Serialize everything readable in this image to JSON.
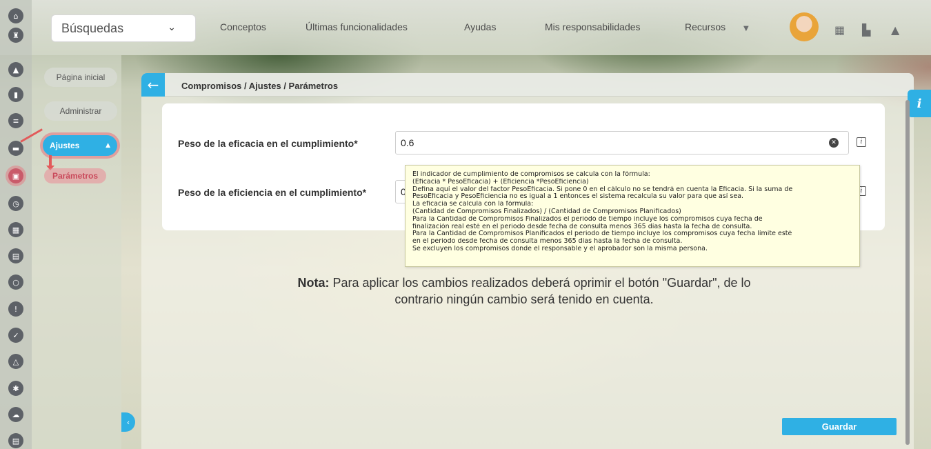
{
  "search": {
    "value": "Búsquedas"
  },
  "nav": {
    "items": [
      "Conceptos",
      "Últimas funcionalidades",
      "Ayudas",
      "Mis responsabilidades",
      "Recursos"
    ]
  },
  "sidebar": {
    "pagina_inicial": "Página inicial",
    "administrar": "Administrar",
    "ajustes": "Ajustes",
    "parametros": "Parámetros"
  },
  "panel": {
    "breadcrumb": "Compromisos / Ajustes / Parámetros"
  },
  "form": {
    "eficacia_label": "Peso de la eficacia en el cumplimiento*",
    "eficacia_value": "0.6",
    "eficiencia_label": "Peso de la eficiencia en el cumplimiento*",
    "eficiencia_value": "0"
  },
  "tooltip": {
    "lines": [
      "El indicador de cumplimiento de compromisos se calcula con la fórmula:",
      "(Eficacia * PesoEficacia) + (Eficiencia *PesoEficiencia)",
      "Defina aquí el valor del factor PesoEficacia. Si pone 0 en el cálculo no se tendrá en cuenta la Eficacia. Si la suma de",
      "PesoEficacia y PesoEficiencia no es igual a 1 entonces el sistema recalcula su valor para que así sea.",
      "La eficacia se calcula con la fórmula:",
      "(Cantidad de Compromisos Finalizados) / (Cantidad de Compromisos Planificados)",
      "Para la Cantidad de Compromisos Finalizados el periodo de tiempo incluye los compromisos cuya fecha de",
      "finalización real esté en el periodo desde fecha de consulta menos 365 días hasta la fecha de consulta.",
      "Para la Cantidad de Compromisos Planificados el periodo de tiempo incluye los compromisos cuya fecha límite esté",
      "en el periodo desde fecha de consulta menos 365 días hasta la fecha de consulta.",
      "Se excluyen los compromisos donde el responsable y el aprobador son la misma persona."
    ]
  },
  "note": {
    "bold": "Nota:",
    "line1": " Para aplicar los cambios realizados deberá oprimir el botón \"Guardar\", de lo",
    "line2": "contrario ningún cambio será tenido en cuenta."
  },
  "buttons": {
    "guardar": "Guardar"
  },
  "colors": {
    "accent": "#2fb0e4",
    "highlight": "#e25a5a"
  }
}
